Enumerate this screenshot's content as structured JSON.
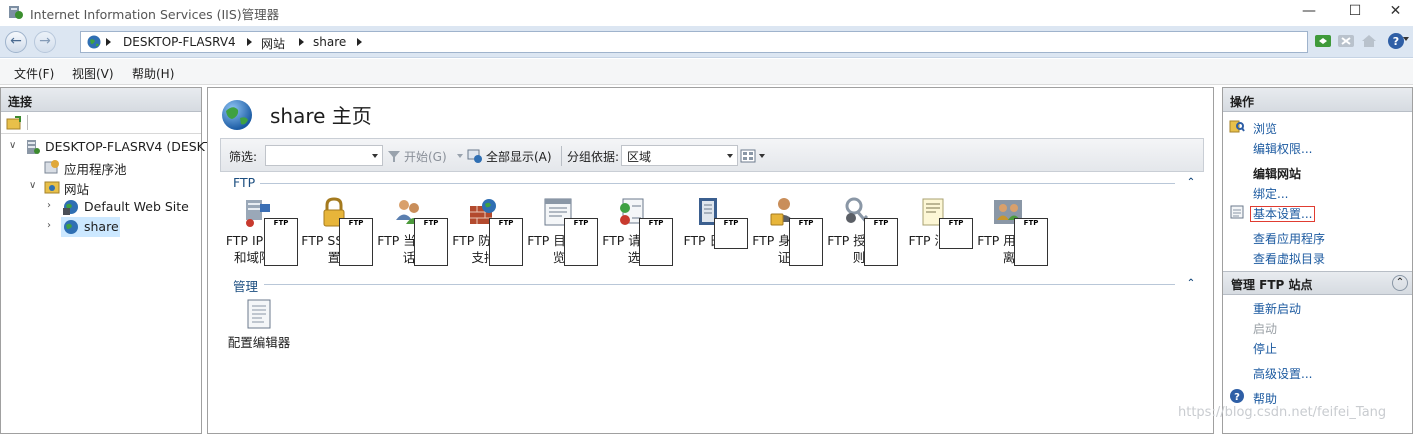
{
  "window": {
    "title": "Internet Information Services (IIS)管理器"
  },
  "address": {
    "crumbs": [
      "DESKTOP-FLASRV4",
      "网站",
      "share"
    ]
  },
  "menu": {
    "items": [
      "文件(F)",
      "视图(V)",
      "帮助(H)"
    ]
  },
  "left": {
    "header": "连接",
    "tree": [
      {
        "label": "DESKTOP-FLASRV4 (DESKT",
        "icon": "server-icon"
      },
      {
        "label": "应用程序池",
        "icon": "app-pool-icon"
      },
      {
        "label": "网站",
        "icon": "sites-folder-icon"
      },
      {
        "label": "Default Web Site",
        "icon": "globe-icon"
      },
      {
        "label": "share",
        "icon": "globe-icon"
      }
    ]
  },
  "center": {
    "title": "share 主页",
    "filter": {
      "label": "筛选:",
      "start": "开始(G)",
      "show_all": "全部显示(A)",
      "group_by_label": "分组依据:",
      "group_by_value": "区域"
    },
    "groups": [
      {
        "name": "FTP",
        "features": [
          {
            "line1": "FTP IP 地址",
            "line2": "和域限制",
            "icon": "ip-restriction-icon"
          },
          {
            "line1": "FTP SSL 设",
            "line2": "置",
            "icon": "lock-icon"
          },
          {
            "line1": "FTP 当前会",
            "line2": "话",
            "icon": "users-icon"
          },
          {
            "line1": "FTP 防火墙",
            "line2": "支持",
            "icon": "firewall-icon"
          },
          {
            "line1": "FTP 目录浏",
            "line2": "览",
            "icon": "directory-icon"
          },
          {
            "line1": "FTP 请求筛",
            "line2": "选",
            "icon": "request-filter-icon"
          },
          {
            "line1": "FTP 日志",
            "line2": "",
            "icon": "log-icon"
          },
          {
            "line1": "FTP 身份验",
            "line2": "证",
            "icon": "auth-icon"
          },
          {
            "line1": "FTP 授权规",
            "line2": "则",
            "icon": "key-icon"
          },
          {
            "line1": "FTP 消息",
            "line2": "",
            "icon": "message-icon"
          },
          {
            "line1": "FTP 用户隔",
            "line2": "离",
            "icon": "user-isolation-icon"
          }
        ]
      },
      {
        "name": "管理",
        "features": [
          {
            "line1": "配置编辑器",
            "line2": "",
            "icon": "config-editor-icon"
          }
        ]
      }
    ]
  },
  "right": {
    "header": "操作",
    "actions1": [
      "浏览",
      "编辑权限..."
    ],
    "section_edit": "编辑网站",
    "actions2": [
      "绑定...",
      "基本设置...",
      "查看应用程序",
      "查看虚拟目录"
    ],
    "section_ftp": "管理 FTP 站点",
    "actions3": [
      "重新启动",
      "启动",
      "停止"
    ],
    "advanced": "高级设置...",
    "help": "帮助"
  },
  "watermark": "https://blog.csdn.net/feifei_Tang"
}
